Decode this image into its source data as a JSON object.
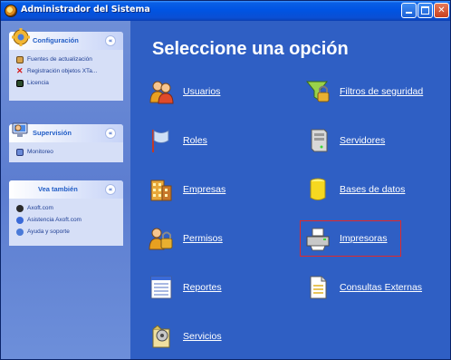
{
  "window": {
    "title": "Administrador del Sistema",
    "controls": [
      "minimize",
      "maximize",
      "close"
    ]
  },
  "sidebar": {
    "panels": [
      {
        "title": "Configuración",
        "icon": "gear-icon",
        "items": [
          {
            "label": "Fuentes de actualización",
            "icon": "sources-icon"
          },
          {
            "label": "Registración objetos XTa...",
            "icon": "x-icon"
          },
          {
            "label": "Licencia",
            "icon": "license-icon"
          }
        ]
      },
      {
        "title": "Supervisión",
        "icon": "monitor-icon",
        "items": [
          {
            "label": "Monitoreo",
            "icon": "chart-icon"
          }
        ]
      },
      {
        "title": "Vea también",
        "icon": "",
        "items": [
          {
            "label": "Axoft.com",
            "icon": "globe-icon"
          },
          {
            "label": "Asistencia Axoft.com",
            "icon": "support-icon"
          },
          {
            "label": "Ayuda y soporte",
            "icon": "help-icon"
          }
        ]
      }
    ]
  },
  "main": {
    "heading": "Seleccione una opción",
    "options": [
      {
        "label": "Usuarios",
        "icon": "users-icon"
      },
      {
        "label": "Filtros de seguridad",
        "icon": "filter-lock-icon"
      },
      {
        "label": "Roles",
        "icon": "flag-icon"
      },
      {
        "label": "Servidores",
        "icon": "server-icon"
      },
      {
        "label": "Empresas",
        "icon": "building-icon"
      },
      {
        "label": "Bases de datos",
        "icon": "database-icon"
      },
      {
        "label": "Permisos",
        "icon": "permissions-icon"
      },
      {
        "label": "Impresoras",
        "icon": "printer-icon"
      },
      {
        "label": "Reportes",
        "icon": "report-icon"
      },
      {
        "label": "Consultas Externas",
        "icon": "document-icon"
      },
      {
        "label": "Servicios",
        "icon": "services-icon"
      }
    ],
    "selected_option": "Impresoras"
  },
  "colors": {
    "titlebar": "#0054e3",
    "main_bg": "#2f5fc4",
    "sidebar_bg": "#6f8fd7",
    "selection_border": "#e02a2a"
  }
}
